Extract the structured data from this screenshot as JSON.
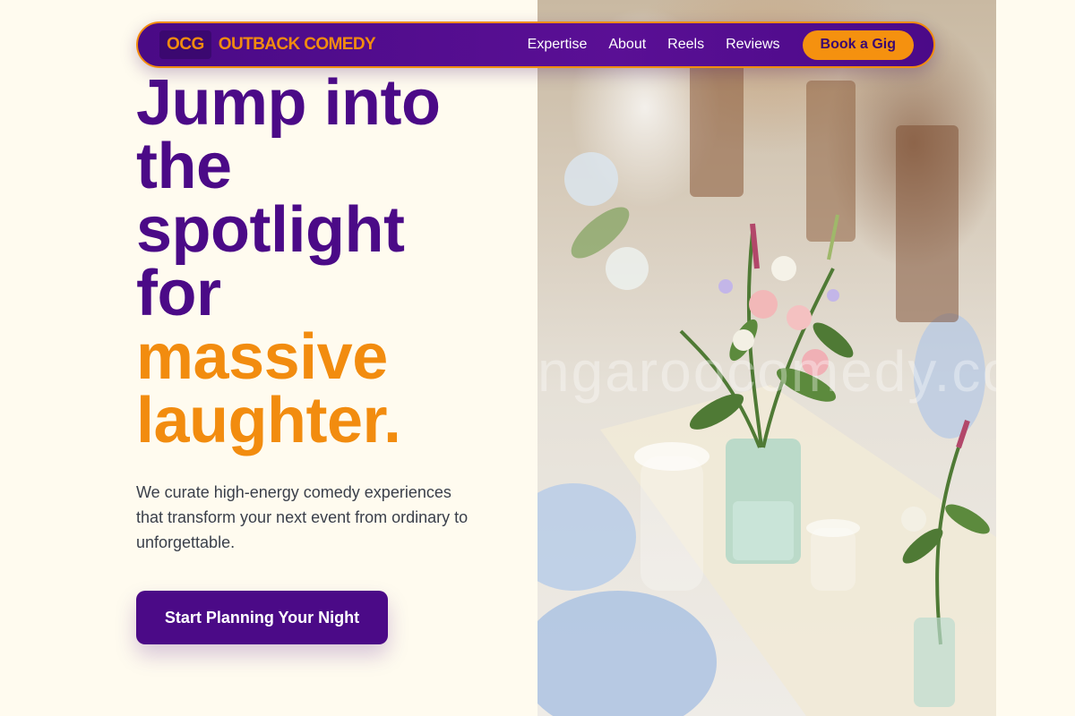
{
  "brand": {
    "badge": "OCG",
    "name": "OUTBACK COMEDY"
  },
  "nav": {
    "links": [
      {
        "label": "Expertise"
      },
      {
        "label": "About"
      },
      {
        "label": "Reels"
      },
      {
        "label": "Reviews"
      }
    ],
    "cta_label": "Book a Gig"
  },
  "hero": {
    "headline_purple": [
      "Jump into",
      "the",
      "spotlight",
      "for"
    ],
    "headline_orange": [
      "massive",
      "laughter."
    ],
    "subtext": "We curate high-energy comedy experiences that transform your next event from ordinary to unforgettable.",
    "cta_label": "Start Planning Your Night",
    "image_watermark": "ngaroocomedy.co"
  },
  "colors": {
    "primary_purple": "#4b0a87",
    "accent_orange": "#f28c0f",
    "background_cream": "#fffbef",
    "body_text": "#3a3f4a"
  }
}
